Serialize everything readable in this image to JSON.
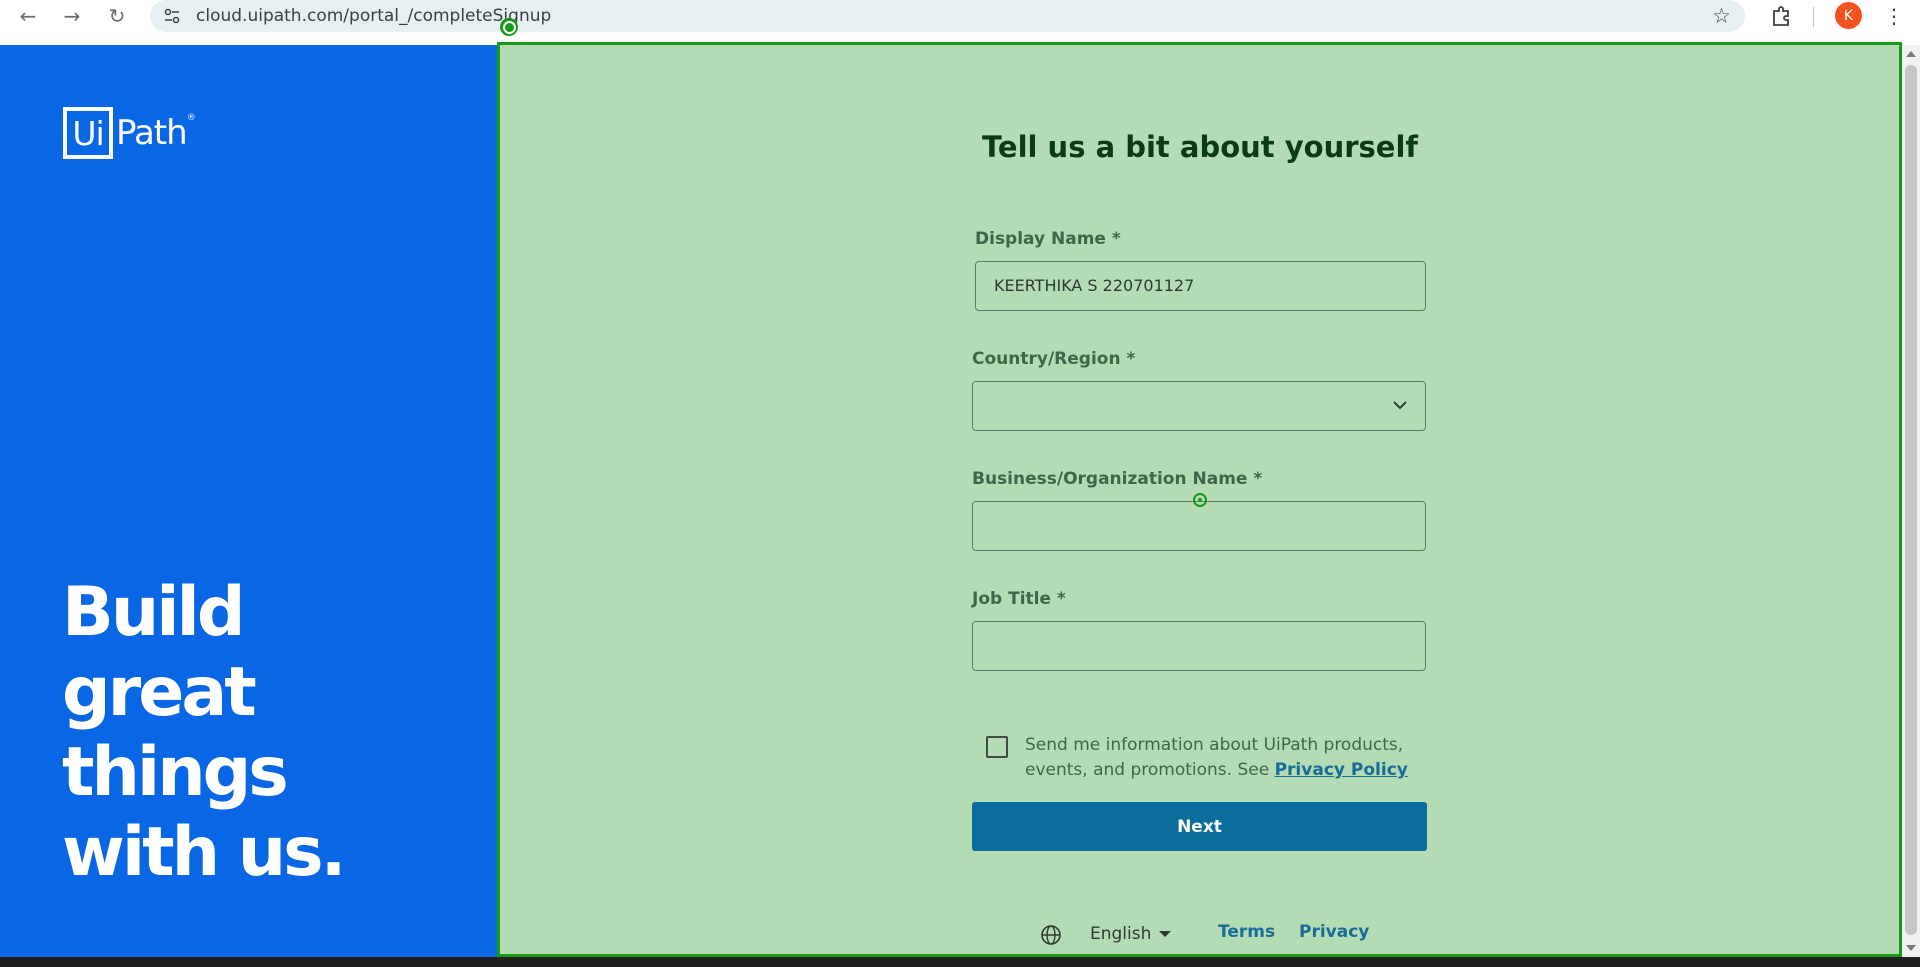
{
  "browser": {
    "url": "cloud.uipath.com/portal_/completeSignup",
    "profile_initial": "K",
    "icons": [
      "back-icon",
      "forward-icon",
      "reload-icon",
      "site-info-icon",
      "bookmark-star-icon",
      "extensions-icon",
      "menu-dots-icon"
    ]
  },
  "brand": {
    "logo_box": "Ui",
    "logo_text": "Path",
    "logo_reg": "®",
    "hero_lines": [
      "Build",
      "great",
      "things",
      "with us."
    ],
    "colors": {
      "left_panel": "#0967e5",
      "form_panel": "#b3dcb4",
      "accent_border": "#169a18",
      "primary_button": "#0a6d9e",
      "link": "#1a6c98"
    }
  },
  "form": {
    "title": "Tell us a bit about yourself",
    "display_name": {
      "label": "Display Name *",
      "value": "KEERTHIKA S 220701127"
    },
    "country": {
      "label": "Country/Region *",
      "value": ""
    },
    "business": {
      "label": "Business/Organization Name *",
      "value": ""
    },
    "job_title": {
      "label": "Job Title *",
      "value": ""
    },
    "consent": {
      "text": "Send me information about UiPath products, events, and promotions. See ",
      "link": "Privacy Policy",
      "checked": false
    },
    "next_label": "Next"
  },
  "footer": {
    "language": "English",
    "terms": "Terms",
    "privacy": "Privacy"
  }
}
